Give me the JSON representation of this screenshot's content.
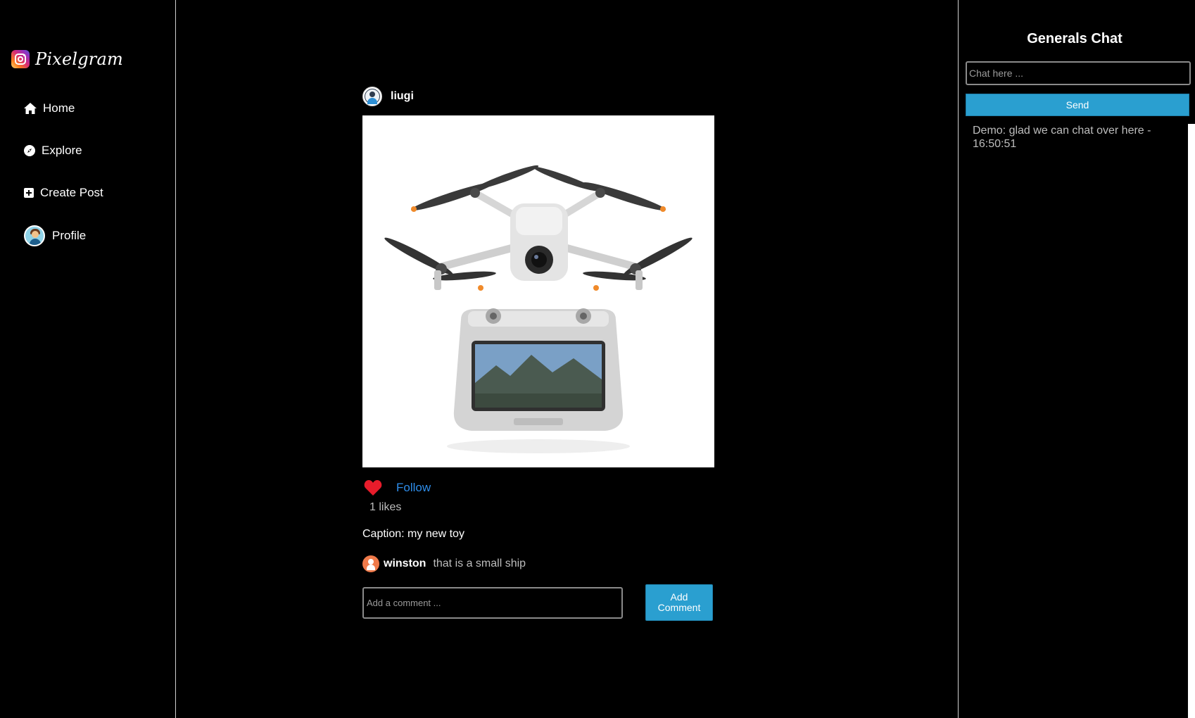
{
  "app": {
    "logo_text": "Pixelgram"
  },
  "sidebar": {
    "items": [
      {
        "label": "Home",
        "icon": "home-icon"
      },
      {
        "label": "Explore",
        "icon": "compass-icon"
      },
      {
        "label": "Create Post",
        "icon": "plus-square-icon"
      },
      {
        "label": "Profile",
        "icon": "avatar"
      }
    ]
  },
  "post": {
    "username": "liugi",
    "follow_label": "Follow",
    "likes_text": "1 likes",
    "liked": true,
    "like_color": "#e81c2b",
    "caption": "Caption: my new toy",
    "comments": [
      {
        "user": "winston",
        "text": "that is a small ship"
      }
    ],
    "comment_placeholder": "Add a comment ...",
    "add_comment_label": "Add Comment"
  },
  "chat": {
    "title": "Generals Chat",
    "input_placeholder": "Chat here ...",
    "send_label": "Send",
    "messages": [
      {
        "text": "Demo: glad we can chat over here - 16:50:51"
      }
    ]
  },
  "colors": {
    "accent": "#2a9fd0",
    "link": "#2e8dea",
    "background": "#000000"
  }
}
